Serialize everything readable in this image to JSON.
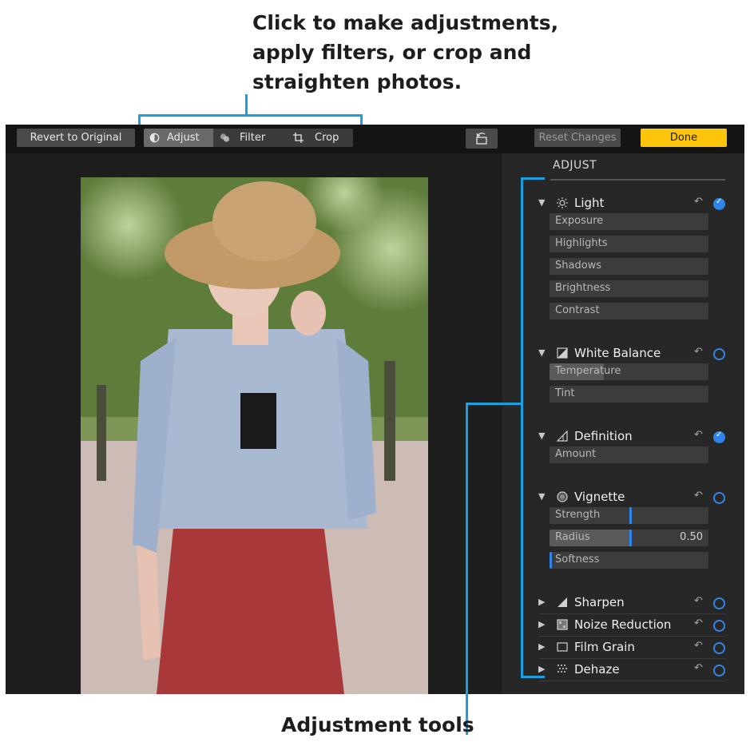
{
  "callouts": {
    "top_lines": [
      "Click to make adjustments,",
      "apply filters, or crop and",
      "straighten photos."
    ],
    "bottom": "Adjustment tools",
    "line_color": "#1aa0e0"
  },
  "toolbar": {
    "revert_label": "Revert to Original",
    "tabs": [
      {
        "label": "Adjust",
        "icon": "adjust-icon",
        "selected": true
      },
      {
        "label": "Filter",
        "icon": "filter-icon",
        "selected": false
      },
      {
        "label": "Crop",
        "icon": "crop-icon",
        "selected": false
      }
    ],
    "rotate_icon": "rotate-icon",
    "reset_label": "Reset Changes",
    "done_label": "Done",
    "done_color": "#ffc50a"
  },
  "panel": {
    "title": "ADJUST",
    "sections": [
      {
        "name": "Light",
        "icon": "sun-icon",
        "expanded": true,
        "active": true,
        "sliders": [
          {
            "label": "Exposure",
            "value": "",
            "fill": 0
          },
          {
            "label": "Highlights",
            "value": "",
            "fill": 0
          },
          {
            "label": "Shadows",
            "value": "",
            "fill": 0
          },
          {
            "label": "Brightness",
            "value": "",
            "fill": 0
          },
          {
            "label": "Contrast",
            "value": "",
            "fill": 0
          }
        ]
      },
      {
        "name": "White Balance",
        "icon": "white-balance-icon",
        "expanded": true,
        "active": false,
        "sliders": [
          {
            "label": "Temperature",
            "value": "",
            "fill": 0.34
          },
          {
            "label": "Tint",
            "value": "",
            "fill": 0
          }
        ]
      },
      {
        "name": "Definition",
        "icon": "definition-icon",
        "expanded": true,
        "active": true,
        "sliders": [
          {
            "label": "Amount",
            "value": "",
            "fill": 0
          }
        ]
      },
      {
        "name": "Vignette",
        "icon": "vignette-icon",
        "expanded": true,
        "active": false,
        "sliders": [
          {
            "label": "Strength",
            "value": "",
            "fill": 0,
            "thumb": 0.5
          },
          {
            "label": "Radius",
            "value": "0.50",
            "fill": 0.5,
            "thumb": 0.5
          },
          {
            "label": "Softness",
            "value": "",
            "fill": 0,
            "thumb": 0.0
          }
        ]
      },
      {
        "name": "Sharpen",
        "icon": "sharpen-icon",
        "expanded": false,
        "active": false,
        "sliders": []
      },
      {
        "name": "Noize Reduction",
        "icon": "noise-reduction-icon",
        "expanded": false,
        "active": false,
        "sliders": []
      },
      {
        "name": "Film Grain",
        "icon": "film-grain-icon",
        "expanded": false,
        "active": false,
        "sliders": []
      },
      {
        "name": "Dehaze",
        "icon": "dehaze-icon",
        "expanded": false,
        "active": false,
        "sliders": []
      }
    ]
  },
  "colors": {
    "accent": "#2f86ea"
  }
}
